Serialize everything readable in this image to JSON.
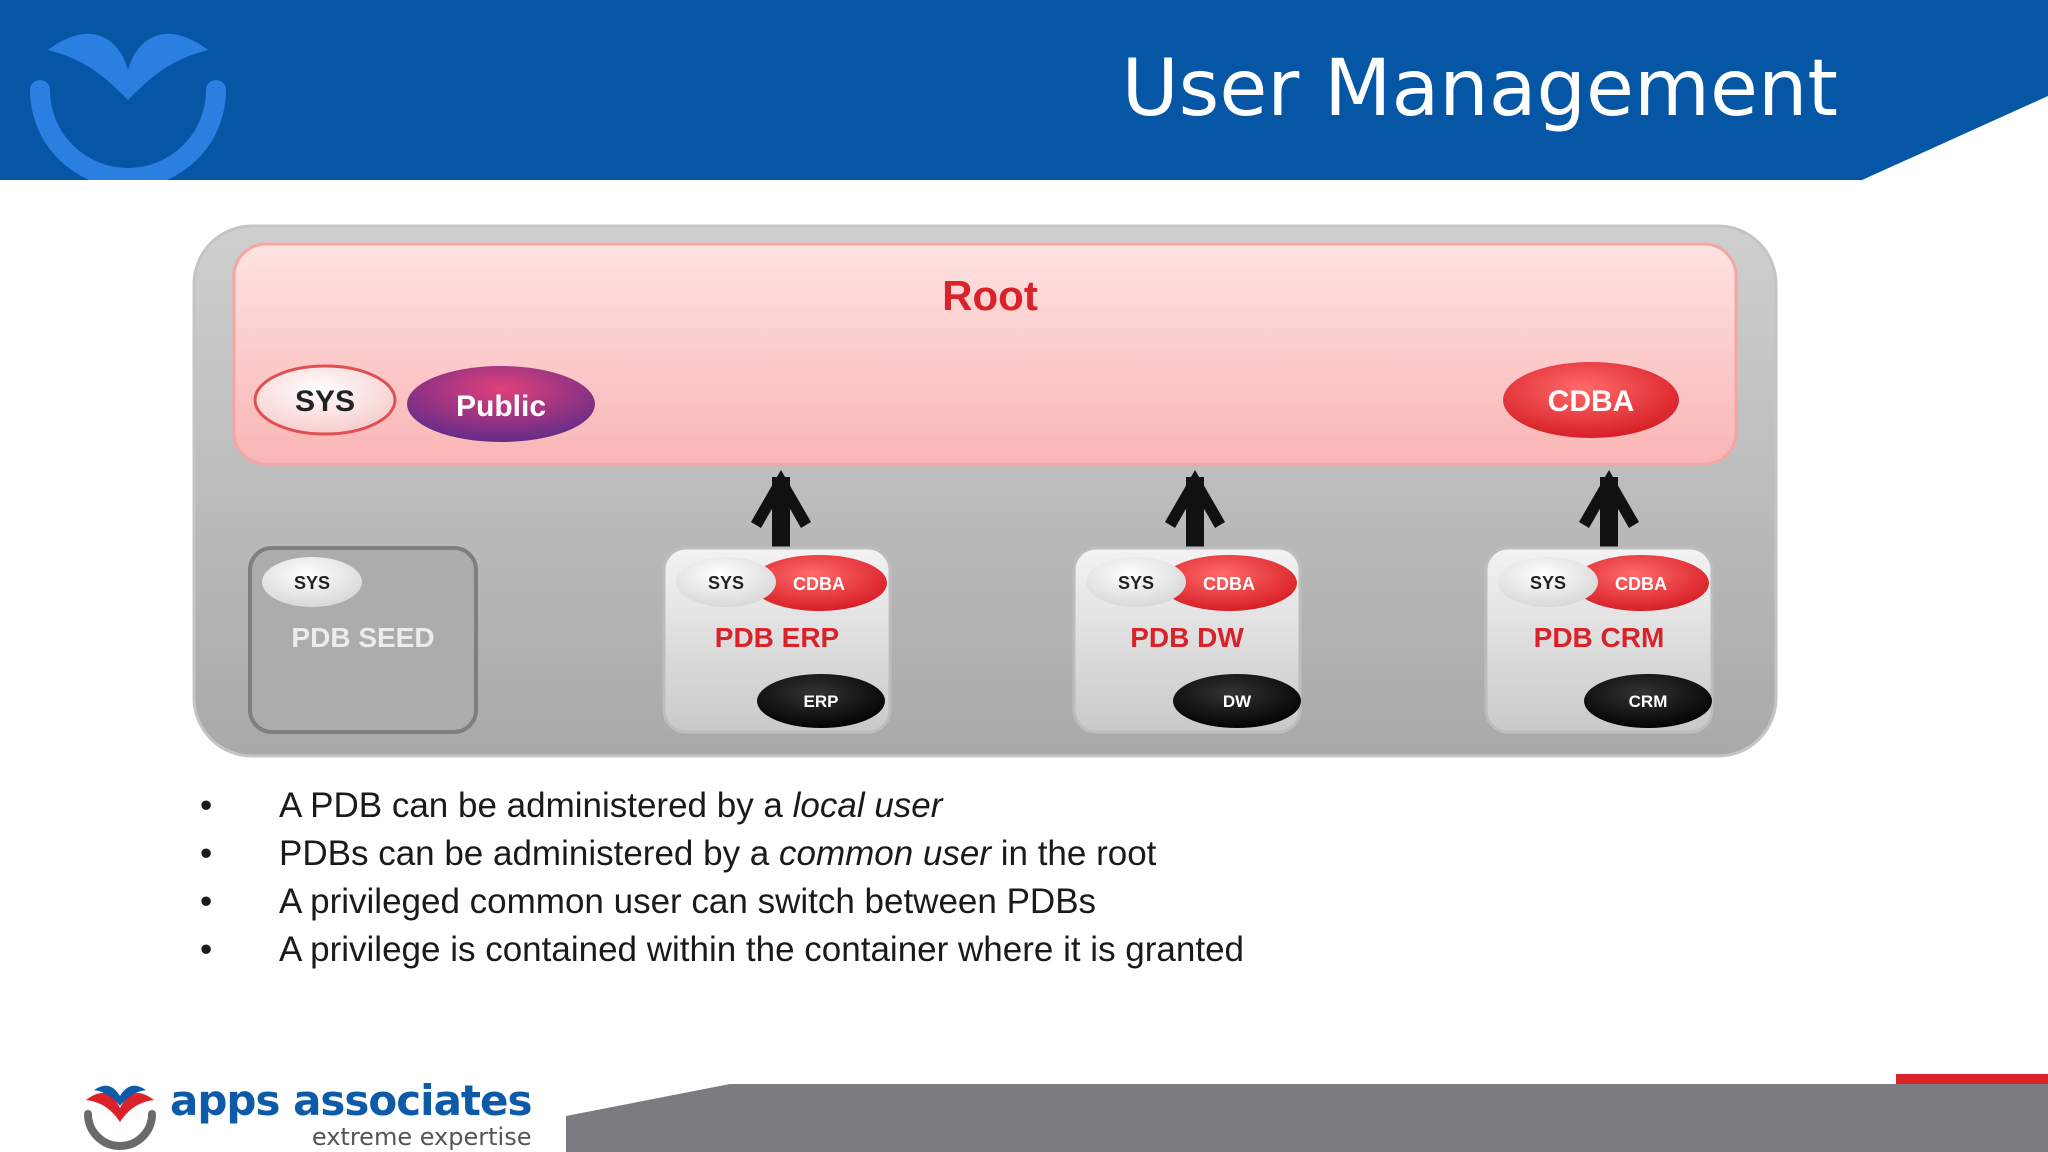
{
  "slide": {
    "title": "User Management"
  },
  "diagram": {
    "root": {
      "label": "Root",
      "users": [
        "SYS",
        "Public",
        "CDBA"
      ]
    },
    "pdbs": [
      {
        "label": "PDB SEED",
        "users": [
          "SYS"
        ],
        "local_user": ""
      },
      {
        "label": "PDB ERP",
        "users": [
          "SYS",
          "CDBA"
        ],
        "local_user": "ERP"
      },
      {
        "label": "PDB DW",
        "users": [
          "SYS",
          "CDBA"
        ],
        "local_user": "DW"
      },
      {
        "label": "PDB CRM",
        "users": [
          "SYS",
          "CDBA"
        ],
        "local_user": "CRM"
      }
    ]
  },
  "bullets": [
    {
      "pre": "A PDB can be administered by a ",
      "em": "local user",
      "post": ""
    },
    {
      "pre": "PDBs can be administered by a ",
      "em": "common user",
      "post": " in the root"
    },
    {
      "pre": "A privileged common user can switch between PDBs",
      "em": "",
      "post": ""
    },
    {
      "pre": "A privilege is contained within the container where it is granted",
      "em": "",
      "post": ""
    }
  ],
  "bullet_glyph": "•",
  "brand": {
    "name": "apps associates",
    "tagline": "extreme expertise"
  },
  "colors": {
    "header_blue": "#0556a5",
    "root_red": "#d9222a",
    "cdba_red": "#e8232c",
    "public_purple": "#7a2a7a",
    "container_gray": "#b5b5b5"
  }
}
